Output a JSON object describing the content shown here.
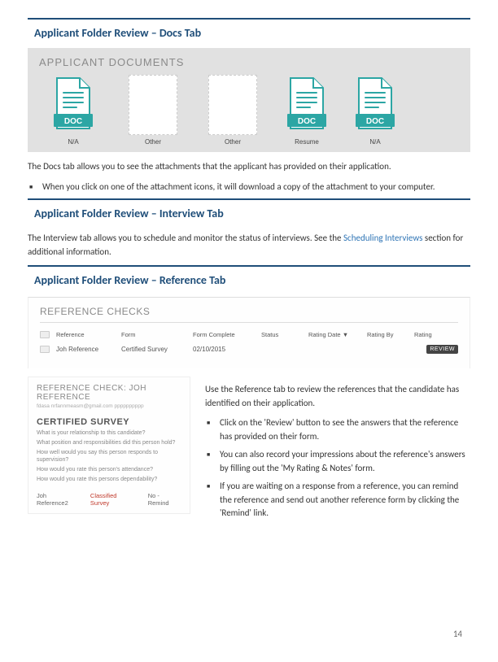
{
  "section1": {
    "title": "Applicant Folder Review – Docs Tab",
    "docs_header": "APPLICANT DOCUMENTS",
    "docs": [
      {
        "label": "N/A",
        "type": "doc"
      },
      {
        "label": "Other",
        "type": "blank"
      },
      {
        "label": "Other",
        "type": "blank"
      },
      {
        "label": "Resume",
        "type": "doc"
      },
      {
        "label": "N/A",
        "type": "doc"
      }
    ],
    "intro": "The Docs tab allows you to see the attachments that the applicant has provided on their application.",
    "bullet1": "When you click on one of the attachment icons, it will download a copy of the attachment to your computer."
  },
  "section2": {
    "title": "Applicant Folder Review – Interview Tab",
    "text_pre": "The Interview tab allows you to schedule and monitor the status of interviews. See the ",
    "link": "Scheduling Interviews",
    "text_post": " section for additional information."
  },
  "section3": {
    "title": "Applicant Folder Review – Reference Tab",
    "ref_header": "REFERENCE CHECKS",
    "table": {
      "headers": [
        "Reference",
        "Form",
        "Form Complete",
        "Status",
        "Rating Date ▼",
        "Rating By",
        "Rating"
      ],
      "row1": {
        "c1": "Joh Reference",
        "c2": "Certified Survey",
        "c3": "02/10/2015"
      },
      "review": "REVIEW"
    },
    "cert": {
      "title": "REFERENCE CHECK: JOH REFERENCE",
      "sub": "fdasa  nrfannmeasm@gmail.com  pppppppppp",
      "h2": "CERTIFIED SURVEY",
      "q1": "What is your relationship to this candidate?",
      "q2": "What position and responsibilities did this person hold?",
      "q3": "How well would you say this person responds to supervision?",
      "q4": "How would you rate this person's attendance?",
      "q5": "How would you rate this persons dependability?",
      "f1": "Joh Reference2",
      "f2": "Classified Survey",
      "f3": "No - Remind"
    },
    "right": {
      "intro": "Use the Reference tab to review the references that the candidate has identified on their application.",
      "b1": "Click on the 'Review' button to see the answers that the reference has provided on their form.",
      "b2": "You can also record your impressions about the reference's answers by filling out the 'My Rating & Notes' form.",
      "b3": "If you are waiting on a response from a reference, you can remind the reference and send out another reference form by clicking the 'Remind' link."
    }
  },
  "page_number": "14",
  "doc_badge": "DOC"
}
